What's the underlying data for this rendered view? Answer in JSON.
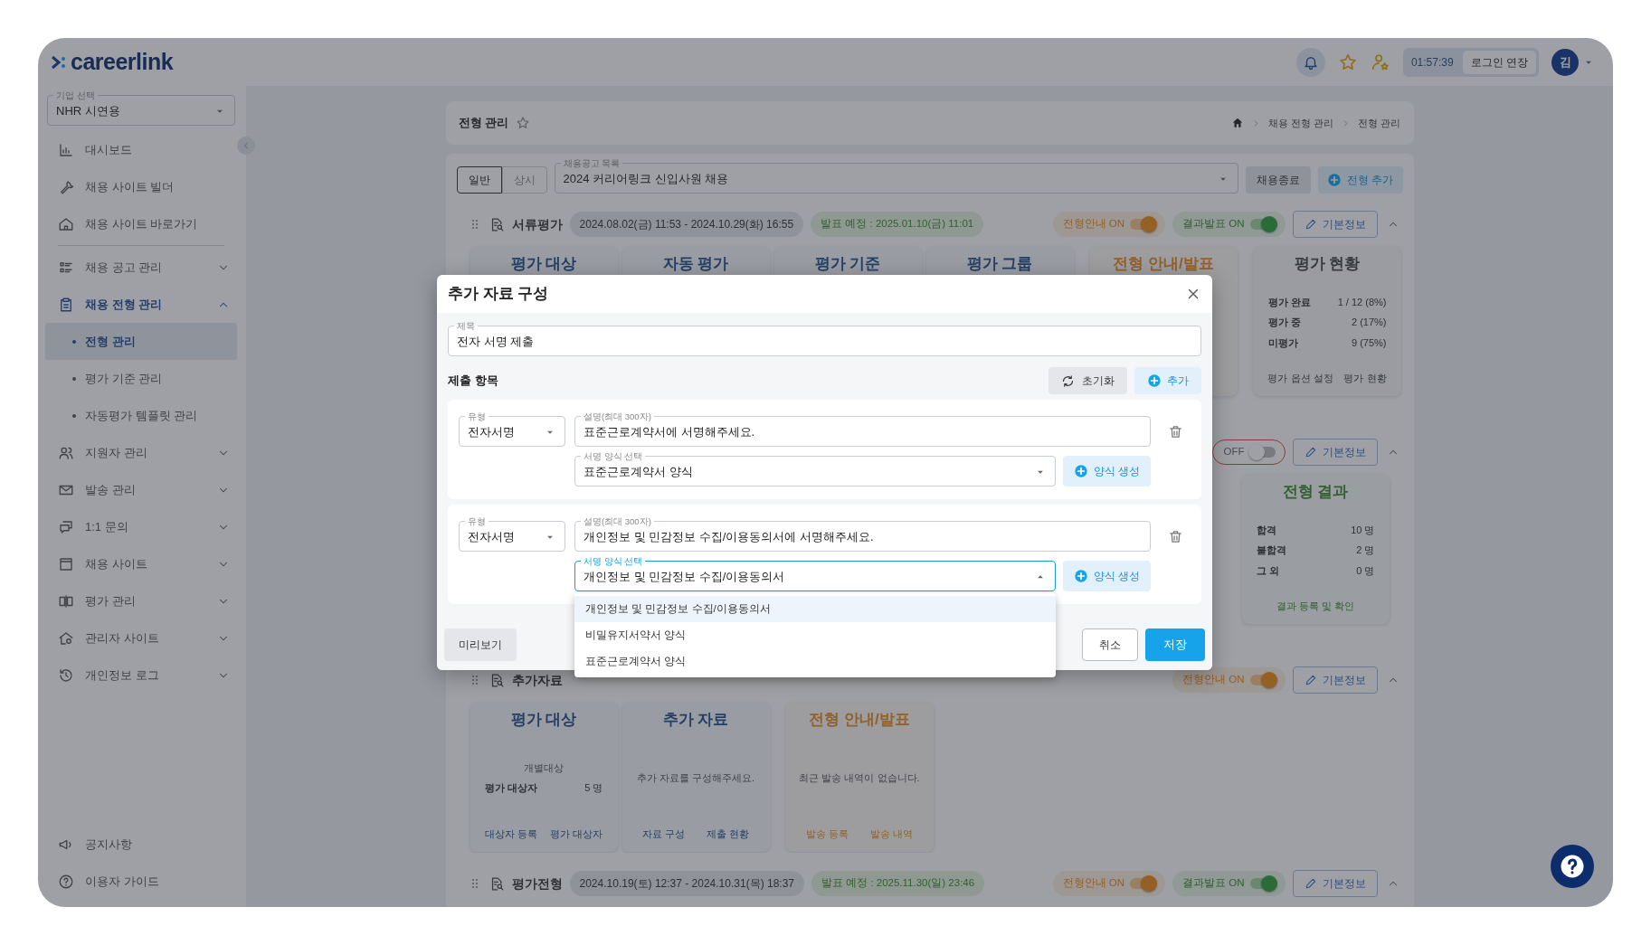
{
  "header": {
    "logo": "careerlink",
    "timer": "01:57:39",
    "extend": "로그인 연장",
    "avatar": "김"
  },
  "sidebar": {
    "company": {
      "label": "기업 선택",
      "value": "NHR 시연용"
    },
    "items": [
      {
        "kind": "link",
        "label": "대시보드"
      },
      {
        "kind": "link",
        "label": "채용 사이트 빌더"
      },
      {
        "kind": "link",
        "label": "채용 사이트 바로가기"
      },
      {
        "kind": "group",
        "label": "채용 공고 관리",
        "expanded": false
      },
      {
        "kind": "group",
        "label": "채용 전형 관리",
        "expanded": true,
        "children": [
          {
            "label": "전형 관리",
            "selected": true
          },
          {
            "label": "평가 기준 관리",
            "selected": false
          },
          {
            "label": "자동평가 템플릿 관리",
            "selected": false
          }
        ]
      },
      {
        "kind": "group",
        "label": "지원자 관리",
        "expanded": false
      },
      {
        "kind": "group",
        "label": "발송 관리",
        "expanded": false
      },
      {
        "kind": "group",
        "label": "1:1 문의",
        "expanded": false
      },
      {
        "kind": "group",
        "label": "채용 사이트",
        "expanded": false
      },
      {
        "kind": "group",
        "label": "평가 관리",
        "expanded": false
      },
      {
        "kind": "group",
        "label": "관리자 사이트",
        "expanded": false
      },
      {
        "kind": "group",
        "label": "개인정보 로그",
        "expanded": false
      }
    ],
    "footer": [
      {
        "label": "공지사항"
      },
      {
        "label": "이용자 가이드"
      }
    ]
  },
  "page": {
    "title": "전형 관리",
    "breadcrumbs": [
      "채용 전형 관리",
      "전형 관리"
    ],
    "tabs": [
      {
        "label": "일반",
        "selected": true
      },
      {
        "label": "상시",
        "selected": false
      }
    ],
    "posting": {
      "label": "채용공고 목록",
      "value": "2024 커리어링크 신입사원 채용"
    },
    "close_button": "채용종료",
    "add_button": "전형 추가"
  },
  "stages": [
    {
      "title": "서류평가",
      "period": "2024.08.02(금) 11:53 - 2024.10.29(화) 16:55",
      "announce": "발표 예정 : 2025.01.10(금) 11:01",
      "toggles": [
        {
          "kind": "guide",
          "label": "전형안내 ON",
          "on": true
        },
        {
          "kind": "result",
          "label": "결과발표 ON",
          "on": true
        }
      ],
      "edit": "기본정보",
      "expanded": true,
      "cards": [
        {
          "kind": "title",
          "title": "평가 대상",
          "color": "#233f66"
        },
        {
          "kind": "title",
          "title": "자동 평가",
          "color": "#233f66"
        },
        {
          "kind": "title",
          "title": "평가 기준",
          "color": "#233f66"
        },
        {
          "kind": "title",
          "title": "평가 그룹",
          "color": "#233f66"
        },
        {
          "kind": "title",
          "title": "전형 안내/발표",
          "color": "#926028"
        },
        {
          "kind": "stats",
          "title": "평가 현황",
          "color": "#373a3e",
          "stats": [
            {
              "label": "평가 완료",
              "value": "1 / 12 (8%)"
            },
            {
              "label": "평가 중",
              "value": "2 (17%)"
            },
            {
              "label": "미평가",
              "value": "9 (75%)"
            }
          ],
          "links": [
            "평가 옵션 설정",
            "평가 현황"
          ]
        }
      ]
    },
    {
      "toggles": [
        {
          "kind": "off",
          "label": "OFF",
          "on": false
        }
      ],
      "edit": "기본정보",
      "expanded": true,
      "cards": [
        {
          "kind": "stats",
          "title": "전형 결과",
          "color": "#326030",
          "stats": [
            {
              "label": "합격",
              "value": "10 명"
            },
            {
              "label": "불합격",
              "value": "2 명"
            },
            {
              "label": "그 외",
              "value": "0 명"
            }
          ],
          "links": [
            "결과 등록 및 확인"
          ]
        }
      ]
    },
    {
      "title": "추가자료",
      "toggles": [
        {
          "kind": "guide",
          "label": "전형안내 ON",
          "on": true
        }
      ],
      "edit": "기본정보",
      "expanded": true,
      "cards": [
        {
          "kind": "stats",
          "title": "평가 대상",
          "color": "#233f66",
          "note": "개별대상",
          "stats": [
            {
              "label": "평가 대상자",
              "value": "5 명"
            }
          ],
          "links": [
            "대상자 등록",
            "평가 대상자"
          ]
        },
        {
          "kind": "message",
          "title": "추가 자료",
          "color": "#233f66",
          "message": "추가 자료를 구성해주세요.",
          "links": [
            "자료 구성",
            "제출 현황"
          ]
        },
        {
          "kind": "message",
          "title": "전형 안내/발표",
          "color": "#926028",
          "message": "최근 발송 내역이 없습니다.",
          "links": [
            "발송 등록",
            "발송 내역"
          ]
        }
      ]
    },
    {
      "title": "평가전형",
      "period": "2024.10.19(토) 12:37 - 2024.10.31(목) 18:37",
      "announce": "발표 예정 : 2025.11.30(일) 23:46",
      "toggles": [
        {
          "kind": "guide",
          "label": "전형안내 ON",
          "on": true
        },
        {
          "kind": "result",
          "label": "결과발표 ON",
          "on": true
        }
      ],
      "edit": "기본정보",
      "expanded": true
    }
  ],
  "modal": {
    "title": "추가 자료 구성",
    "name_field": {
      "label": "제목",
      "value": "전자 서명 제출"
    },
    "section": "제출 항목",
    "reset": "초기화",
    "add": "추가",
    "items": [
      {
        "type": {
          "label": "유형",
          "value": "전자서명"
        },
        "description": {
          "label": "설명(최대 300자)",
          "value": "표준근로계약서에 서명해주세요."
        },
        "form": {
          "label": "서명 양식 선택",
          "value": "표준근로계약서 양식",
          "expanded": false
        },
        "create": "양식 생성"
      },
      {
        "type": {
          "label": "유형",
          "value": "전자서명"
        },
        "description": {
          "label": "설명(최대 300자)",
          "value": "개인정보 및 민감정보 수집/이용동의서에 서명해주세요."
        },
        "form": {
          "label": "서명 양식 선택",
          "value": "개인정보 및 민감정보 수집/이용동의서",
          "expanded": true,
          "options": [
            {
              "label": "개인정보 및 민감정보 수집/이용동의서",
              "selected": true
            },
            {
              "label": "비밀유지서약서 양식",
              "selected": false
            },
            {
              "label": "표준근로계약서 양식",
              "selected": false
            }
          ]
        },
        "create": "양식 생성"
      }
    ],
    "preview": "미리보기",
    "cancel": "취소",
    "save": "저장"
  }
}
